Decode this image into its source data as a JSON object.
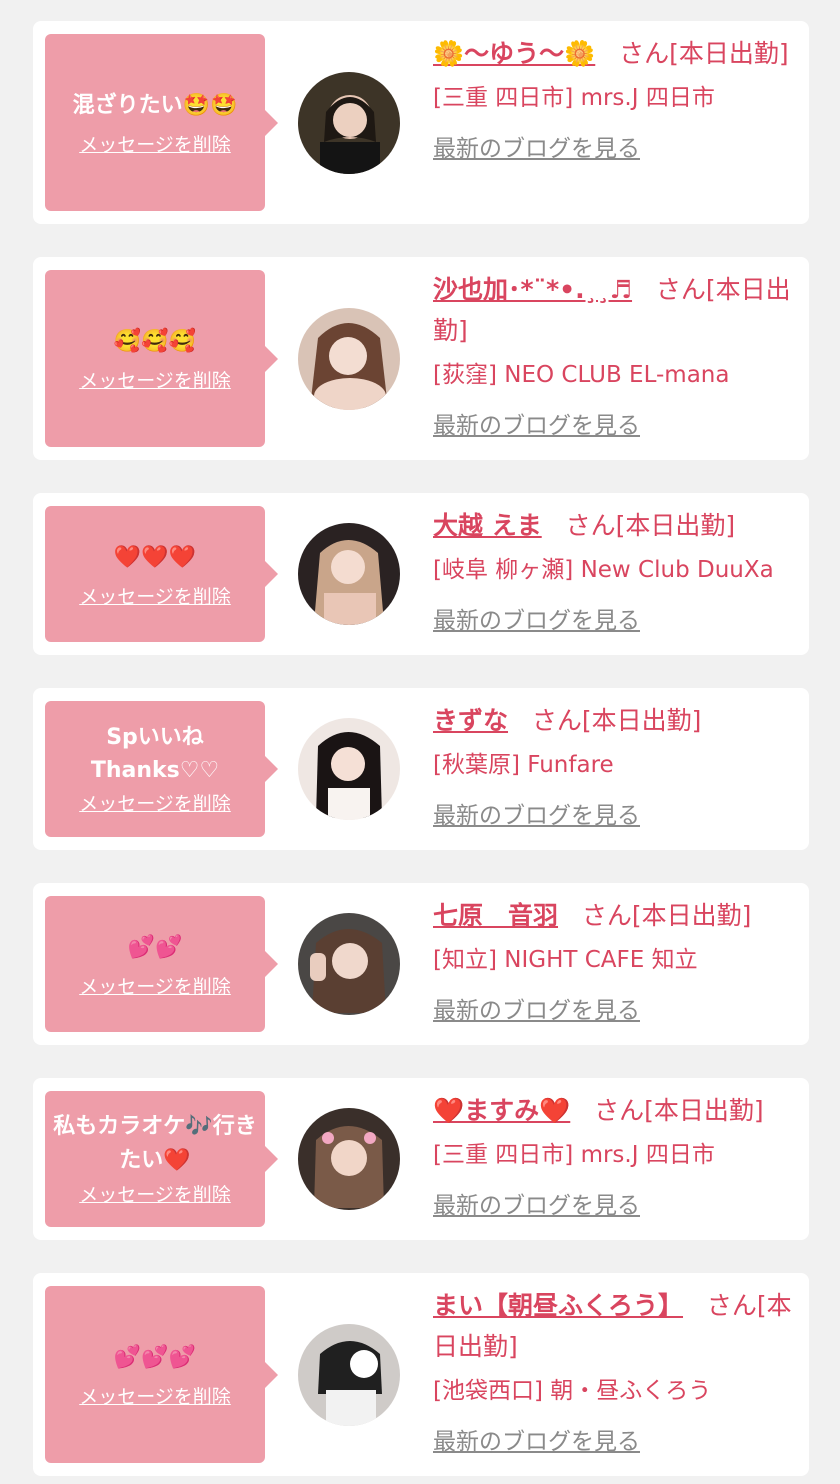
{
  "suffix_text": "さん[本日出勤]",
  "delete_label": "メッセージを削除",
  "blog_label": "最新のブログを見る",
  "colors": {
    "bubble": "#ee9da9",
    "accent": "#d9455f",
    "link_gray": "#8a8a8a",
    "page_bg": "#f1f1f1"
  },
  "cards": [
    {
      "message": "混ざりたい🤩🤩",
      "name": "🌼〜ゆう〜🌼",
      "shop": "[三重 四日市] mrs.J 四日市",
      "avatar": "avatar-photo"
    },
    {
      "message": "🥰🥰🥰",
      "name": "沙也加･*¨*•.¸¸♬",
      "shop": "[荻窪] NEO CLUB EL-mana",
      "avatar": "avatar-photo"
    },
    {
      "message": "❤️❤️❤️",
      "name": "大越 えま",
      "shop": "[岐阜 柳ヶ瀬] New Club DuuXa",
      "avatar": "avatar-photo"
    },
    {
      "message": "Spいいね\nThanks♡♡",
      "name": "きずな",
      "shop": "[秋葉原] Funfare",
      "avatar": "avatar-photo"
    },
    {
      "message": "💕💕",
      "name": "七原　音羽",
      "shop": "[知立] NIGHT CAFE 知立",
      "avatar": "avatar-photo"
    },
    {
      "message": "私もカラオケ🎶行きたい❤️",
      "name": "❤️ますみ❤️",
      "shop": "[三重 四日市] mrs.J 四日市",
      "avatar": "avatar-photo"
    },
    {
      "message": "💕💕💕",
      "name": "まい【朝昼ふくろう】",
      "shop": "[池袋西口] 朝・昼ふくろう",
      "avatar": "avatar-photo"
    }
  ]
}
